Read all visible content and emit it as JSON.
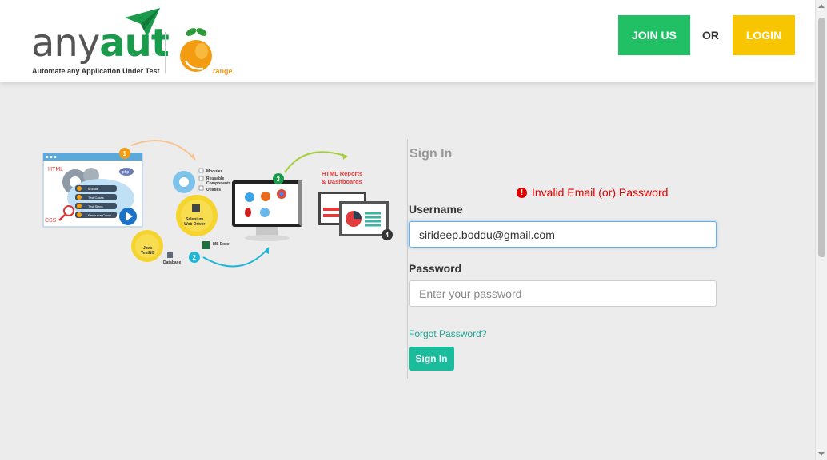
{
  "header": {
    "logo": {
      "part1": "any",
      "part2": "aut",
      "tagline": "Automate any Application Under Test",
      "orange_label": "range"
    },
    "join_label": "JOIN US",
    "or_label": "OR",
    "login_label": "LOGIN"
  },
  "illustration": {
    "html_label": "HTML",
    "css_label": "CSS",
    "php_label": "php",
    "steps": [
      "1",
      "2",
      "3",
      "4"
    ],
    "menu_items": [
      "Module",
      "Test Cases",
      "Test Steps",
      "Resource Comp"
    ],
    "list_items": [
      "Modules",
      "Reusable",
      "Components",
      "Utilities"
    ],
    "selenium_label": "Selenium",
    "webdriver_label": "Web Driver",
    "java_label": "Java",
    "testng_label": "TestNG",
    "database_label": "Database",
    "excel_label": "MS Excel",
    "report_title_1": "HTML Reports",
    "report_title_2": "& Dashboards"
  },
  "signin": {
    "title": "Sign In",
    "error": "Invalid Email (or) Password",
    "username_label": "Username",
    "username_value": "sirideep.boddu@gmail.com",
    "password_label": "Password",
    "password_placeholder": "Enter your password",
    "forgot_label": "Forgot Password?",
    "button_label": "Sign In"
  },
  "colors": {
    "join": "#21c064",
    "login": "#f7c600",
    "signin_button": "#1abc9c",
    "error": "#e00000",
    "link": "#1ba390"
  }
}
